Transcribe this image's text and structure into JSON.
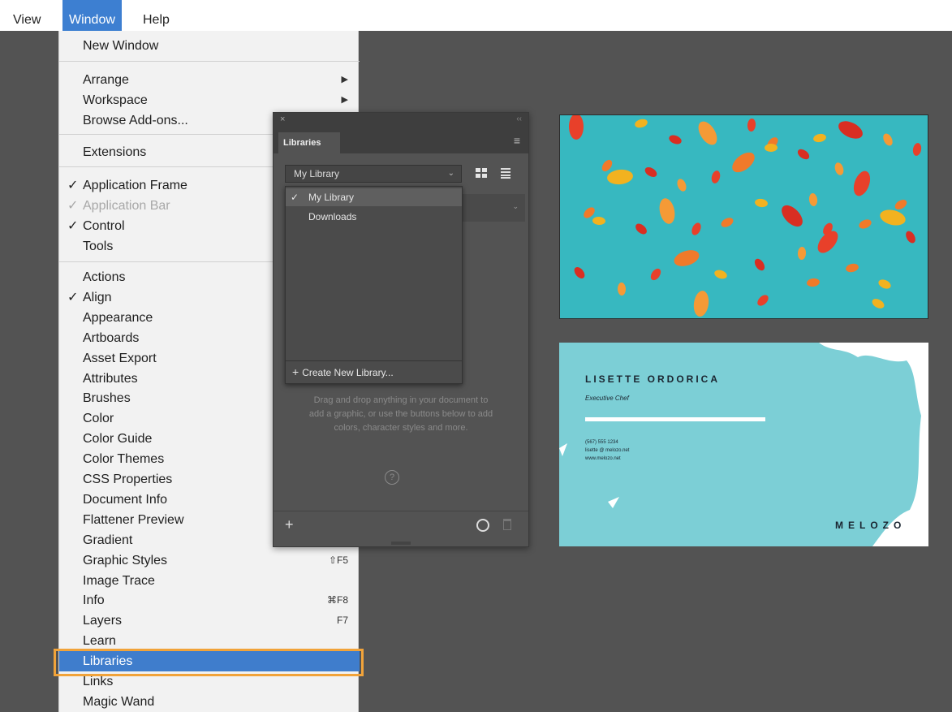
{
  "menubar": {
    "items": [
      {
        "label": "View"
      },
      {
        "label": "Window"
      },
      {
        "label": "Help"
      }
    ]
  },
  "window_menu": {
    "new_window": "New Window",
    "arrange": "Arrange",
    "workspace": "Workspace",
    "browse_addons": "Browse Add-ons...",
    "extensions": "Extensions",
    "application_frame": "Application Frame",
    "application_bar": "Application Bar",
    "control": "Control",
    "tools": "Tools",
    "checkmark": "✓",
    "submenu_arrow": "▶",
    "panels": [
      {
        "label": "Actions",
        "checked": "",
        "shortcut": ""
      },
      {
        "label": "Align",
        "checked": "✓",
        "shortcut": ""
      },
      {
        "label": "Appearance",
        "checked": "",
        "shortcut": ""
      },
      {
        "label": "Artboards",
        "checked": "",
        "shortcut": ""
      },
      {
        "label": "Asset Export",
        "checked": "",
        "shortcut": ""
      },
      {
        "label": "Attributes",
        "checked": "",
        "shortcut": ""
      },
      {
        "label": "Brushes",
        "checked": "",
        "shortcut": ""
      },
      {
        "label": "Color",
        "checked": "",
        "shortcut": ""
      },
      {
        "label": "Color Guide",
        "checked": "",
        "shortcut": ""
      },
      {
        "label": "Color Themes",
        "checked": "",
        "shortcut": ""
      },
      {
        "label": "CSS Properties",
        "checked": "",
        "shortcut": ""
      },
      {
        "label": "Document Info",
        "checked": "",
        "shortcut": ""
      },
      {
        "label": "Flattener Preview",
        "checked": "",
        "shortcut": ""
      },
      {
        "label": "Gradient",
        "checked": "",
        "shortcut": ""
      },
      {
        "label": "Graphic Styles",
        "checked": "",
        "shortcut": "⇧F5"
      },
      {
        "label": "Image Trace",
        "checked": "",
        "shortcut": ""
      },
      {
        "label": "Info",
        "checked": "",
        "shortcut": "⌘F8"
      },
      {
        "label": "Layers",
        "checked": "",
        "shortcut": "F7"
      },
      {
        "label": "Learn",
        "checked": "",
        "shortcut": ""
      },
      {
        "label": "Libraries",
        "checked": "",
        "shortcut": ""
      },
      {
        "label": "Links",
        "checked": "",
        "shortcut": ""
      },
      {
        "label": "Magic Wand",
        "checked": "",
        "shortcut": ""
      }
    ]
  },
  "libraries_panel": {
    "close": "×",
    "collapse": "‹‹",
    "tab": "Libraries",
    "menu_icon": "≡",
    "selected_library": "My Library",
    "chevron": "⌄",
    "dropdown": {
      "items": [
        {
          "label": "My Library",
          "checked": "✓"
        },
        {
          "label": "Downloads",
          "checked": ""
        }
      ],
      "create": "Create New Library...",
      "create_plus": "+"
    },
    "help_text": "Drag and drop anything in your document to add a graphic, or use the buttons below to add colors, character styles and more.",
    "help_icon": "?",
    "add": "+"
  },
  "business_card": {
    "name": "LISETTE ORDORICA",
    "role": "Executive Chef",
    "phone": "(567) 555 1234",
    "email": "lisette @ melozo.net",
    "web": "www.melozo.net",
    "brand": "MELOZO",
    "accent": "#7ccfd6"
  },
  "colors": {
    "menu_highlight": "#3f7dcc",
    "callout": "#f1a33a",
    "artwork_teal": "#37b8c0"
  }
}
